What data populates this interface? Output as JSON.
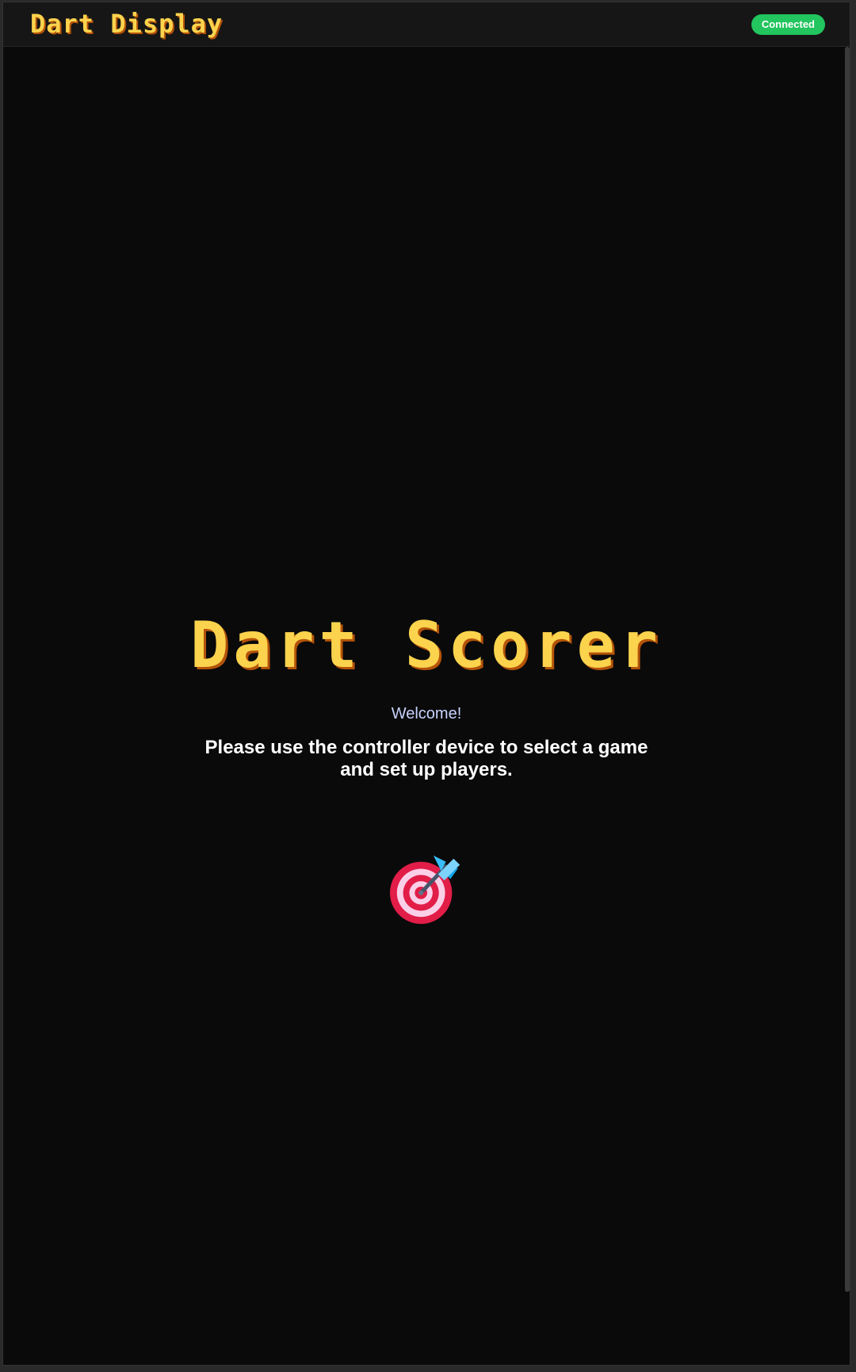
{
  "header": {
    "app_title": "Dart Display",
    "status": "Connected"
  },
  "main": {
    "title": "Dart Scorer",
    "welcome": "Welcome!",
    "instruction": "Please use the controller device to select a game and set up players."
  },
  "icons": {
    "target": "target-dart-icon"
  },
  "colors": {
    "accent_yellow": "#fcd34d",
    "status_green": "#22c55e",
    "background": "#0a0a0a"
  }
}
